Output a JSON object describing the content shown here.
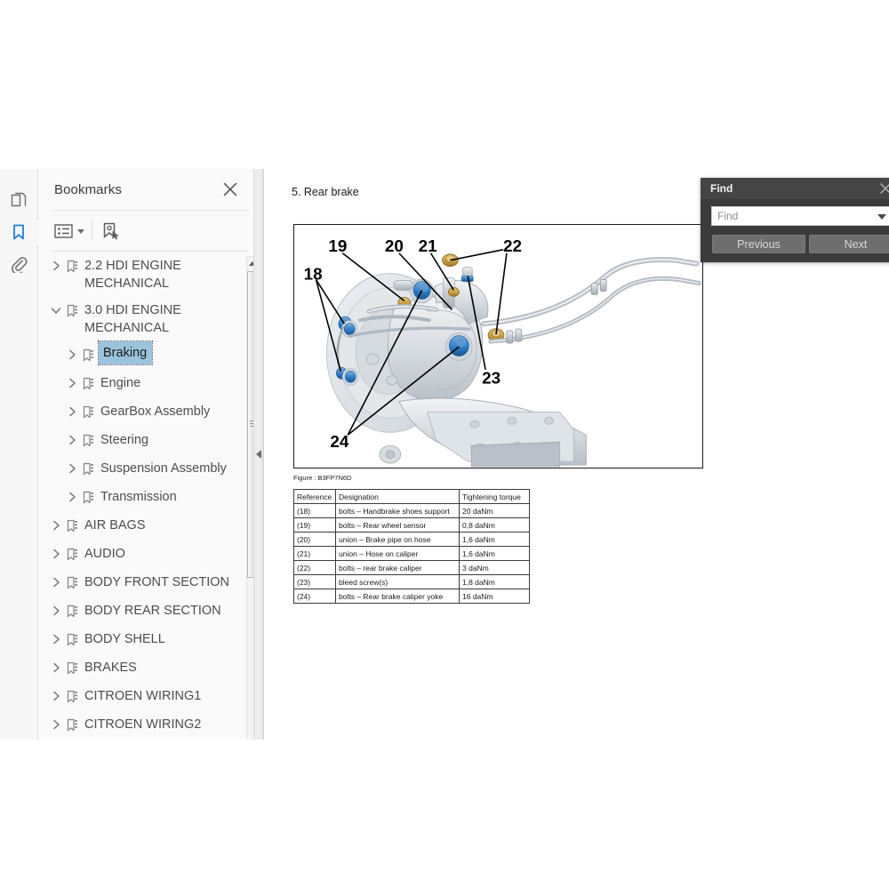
{
  "window": {
    "icon_rail": [
      {
        "name": "page-thumbnails-icon",
        "label": "Page Thumbnails",
        "active": false
      },
      {
        "name": "bookmarks-icon",
        "label": "Bookmarks",
        "active": true
      },
      {
        "name": "attachments-icon",
        "label": "Attachments",
        "active": false
      }
    ]
  },
  "bookmarks_panel": {
    "title": "Bookmarks",
    "close_label": "✕",
    "toolbar": {
      "options_label": "Options",
      "new_bookmark_label": "New Bookmark"
    },
    "items": [
      {
        "label": "2.2 HDI ENGINE\nMECHANICAL",
        "level": 0,
        "expanded": false,
        "selected": false
      },
      {
        "label": "3.0 HDI ENGINE\nMECHANICAL",
        "level": 0,
        "expanded": true,
        "selected": false
      },
      {
        "label": "Braking",
        "level": 1,
        "expanded": false,
        "selected": true
      },
      {
        "label": "Engine",
        "level": 1,
        "expanded": false,
        "selected": false
      },
      {
        "label": "GearBox Assembly",
        "level": 1,
        "expanded": false,
        "selected": false
      },
      {
        "label": "Steering",
        "level": 1,
        "expanded": false,
        "selected": false
      },
      {
        "label": "Suspension Assembly",
        "level": 1,
        "expanded": false,
        "selected": false
      },
      {
        "label": "Transmission",
        "level": 1,
        "expanded": false,
        "selected": false
      },
      {
        "label": "AIR BAGS",
        "level": 0,
        "expanded": false,
        "selected": false
      },
      {
        "label": "AUDIO",
        "level": 0,
        "expanded": false,
        "selected": false
      },
      {
        "label": "BODY FRONT SECTION",
        "level": 0,
        "expanded": false,
        "selected": false
      },
      {
        "label": "BODY REAR SECTION",
        "level": 0,
        "expanded": false,
        "selected": false
      },
      {
        "label": "BODY SHELL",
        "level": 0,
        "expanded": false,
        "selected": false
      },
      {
        "label": "BRAKES",
        "level": 0,
        "expanded": false,
        "selected": false
      },
      {
        "label": "CITROEN WIRING1",
        "level": 0,
        "expanded": false,
        "selected": false
      },
      {
        "label": "CITROEN WIRING2",
        "level": 0,
        "expanded": false,
        "selected": false
      }
    ],
    "selected_highlight_color": "#9cc3de"
  },
  "document": {
    "heading": "5. Rear brake",
    "figure_caption": "Figure : B3FP7N6D",
    "figure_callouts": [
      "18",
      "19",
      "20",
      "21",
      "22",
      "23",
      "24"
    ],
    "table": {
      "headers": [
        "Reference",
        "Designation",
        "Tightening torque"
      ],
      "rows": [
        [
          "(18)",
          "bolts – Handbrake shoes support",
          "20 daNm"
        ],
        [
          "(19)",
          "bolts – Rear wheel sensor",
          "0,8 daNm"
        ],
        [
          "(20)",
          "union – Brake pipe on hose",
          "1,6 daNm"
        ],
        [
          "(21)",
          "union – Hose on caliper",
          "1,6 daNm"
        ],
        [
          "(22)",
          "bolts – rear brake caliper",
          "3 daNm"
        ],
        [
          "(23)",
          "bleed screw(s)",
          "1,8 daNm"
        ],
        [
          "(24)",
          "bolts – Rear brake caliper yoke",
          "16 daNm"
        ]
      ]
    }
  },
  "find_dialog": {
    "title": "Find",
    "close_label": "✕",
    "input_value": "",
    "input_placeholder": "Find",
    "previous_label": "Previous",
    "next_label": "Next",
    "background_color": "#3b3b3b",
    "button_color": "#6e6e6e"
  }
}
